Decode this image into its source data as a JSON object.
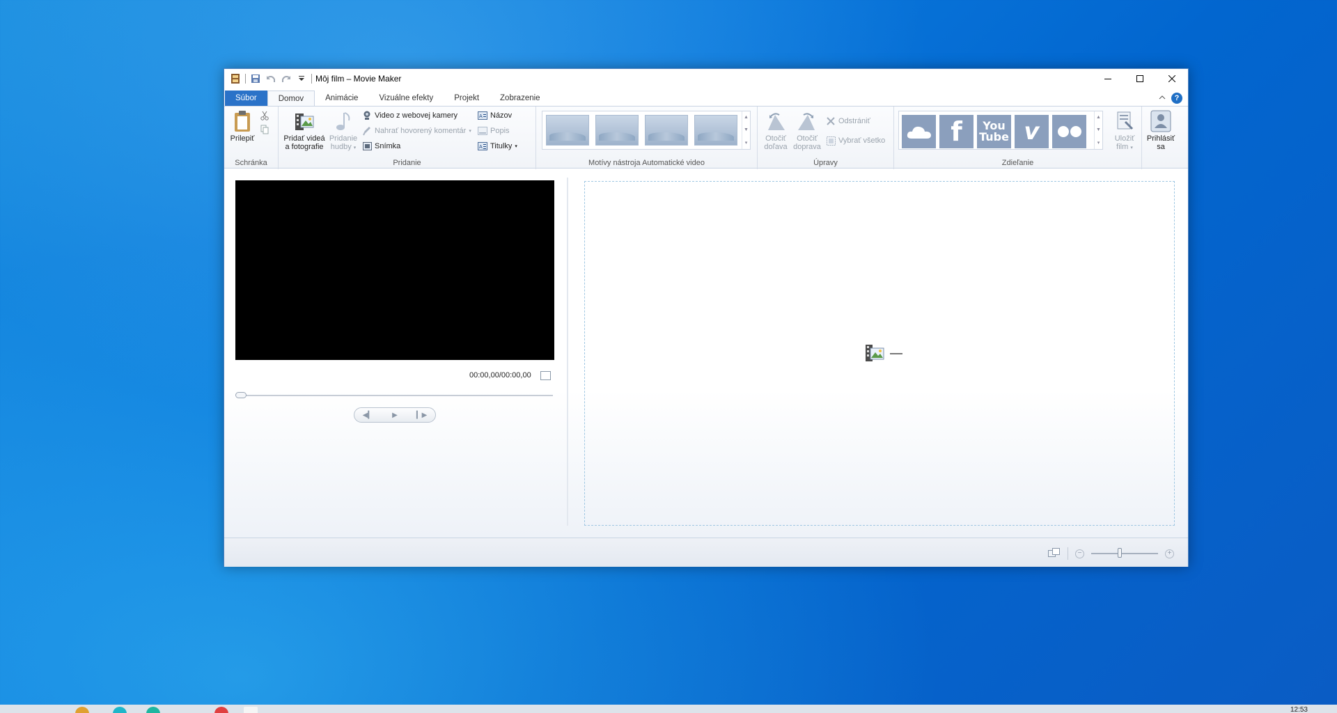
{
  "window": {
    "title": "Môj film – Movie Maker"
  },
  "tabs": [
    {
      "label": "Súbor"
    },
    {
      "label": "Domov"
    },
    {
      "label": "Animácie"
    },
    {
      "label": "Vizuálne efekty"
    },
    {
      "label": "Projekt"
    },
    {
      "label": "Zobrazenie"
    }
  ],
  "help_label": "?",
  "ribbon": {
    "clipboard": {
      "label": "Schránka",
      "paste": "Prilepiť"
    },
    "add": {
      "label": "Pridanie",
      "add_videos_line1": "Pridať videá",
      "add_videos_line2": "a fotografie",
      "add_music_line1": "Pridanie",
      "add_music_line2": "hudby",
      "webcam": "Video z webovej kamery",
      "narration": "Nahrať hovorený komentár",
      "snapshot": "Snímka",
      "title": "Názov",
      "caption": "Popis",
      "credits": "Titulky"
    },
    "themes": {
      "label": "Motívy nástroja Automatické video"
    },
    "editing": {
      "label": "Úpravy",
      "rotate_left_line1": "Otočiť",
      "rotate_left_line2": "doľava",
      "rotate_right_line1": "Otočiť",
      "rotate_right_line2": "doprava",
      "remove": "Odstrániť",
      "select_all": "Vybrať všetko"
    },
    "sharing": {
      "label": "Zdieľanie",
      "youtube_line1": "You",
      "youtube_line2": "Tube",
      "facebook": "f",
      "vimeo": "v",
      "save_movie_line1": "Uložiť",
      "save_movie_line2": "film",
      "sign_in_line1": "Prihlásiť",
      "sign_in_line2": "sa"
    }
  },
  "preview": {
    "timecode": "00:00,00/00:00,00"
  },
  "taskbar": {
    "clock": "12:53"
  },
  "colors": {
    "file_tab": "#2a72c8",
    "desktop": "#0a78dc",
    "service_tile": "#8b9fbd"
  }
}
